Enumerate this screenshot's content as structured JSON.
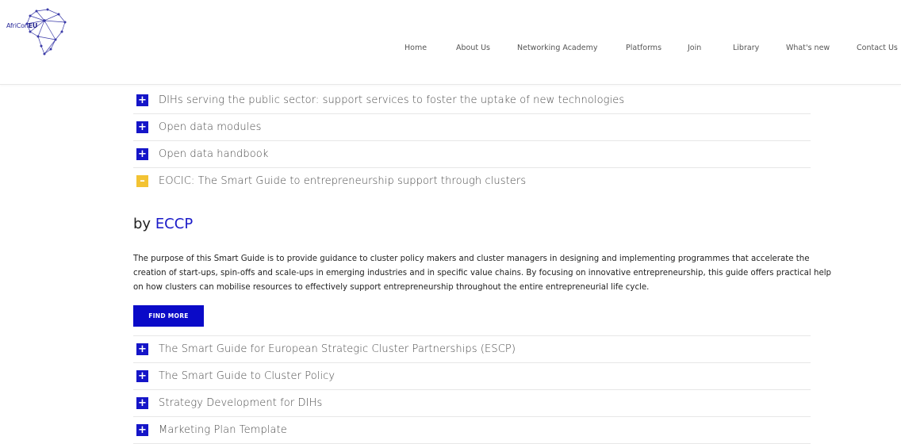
{
  "header": {
    "logo_text_a": "AfriCon",
    "logo_text_b": "EU",
    "nav": [
      "Home",
      "About Us",
      "Networking Academy",
      "Platforms",
      "Join",
      "Library",
      "What's new",
      "Contact Us"
    ]
  },
  "accordion_top": [
    {
      "title": "DIHs serving the public sector: support services to foster the uptake of new technologies",
      "icon": "+",
      "open": false
    },
    {
      "title": "Open data modules",
      "icon": "+",
      "open": false
    },
    {
      "title": "Open data handbook",
      "icon": "+",
      "open": false
    },
    {
      "title": "EOCIC: The Smart Guide to entrepreneurship support through clusters",
      "icon": "–",
      "open": true
    }
  ],
  "detail": {
    "by_prefix": "by ",
    "by_link": "ECCP",
    "description": "The purpose of this Smart Guide is to provide guidance to cluster policy makers and cluster managers in designing and implementing programmes that accelerate the creation of start-ups, spin-offs and scale-ups in emerging industries and in specific value chains. By focusing on innovative entrepreneurship, this guide offers practical help on how clusters can mobilise resources to effectively support entrepreneurship throughout the entire entrepreneurial life cycle.",
    "button_label": "FIND MORE"
  },
  "accordion_bottom": [
    {
      "title": "The Smart Guide for European Strategic Cluster Partnerships (ESCP)",
      "icon": "+"
    },
    {
      "title": "The Smart Guide to Cluster Policy",
      "icon": "+"
    },
    {
      "title": "Strategy Development for DIHs",
      "icon": "+"
    },
    {
      "title": "Marketing Plan Template",
      "icon": "+"
    }
  ],
  "colors": {
    "accent_blue": "#1515c8",
    "accent_yellow": "#f3c333"
  }
}
